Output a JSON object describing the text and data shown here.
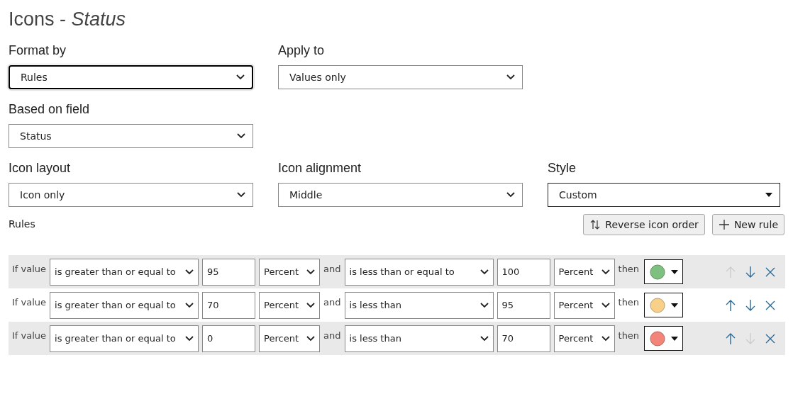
{
  "title": {
    "main": "Icons - ",
    "field": "Status"
  },
  "fields": [
    {
      "label": "Format by",
      "value": "Rules",
      "focused": true,
      "kind": "select"
    },
    {
      "label": "Apply to",
      "value": "Values only",
      "focused": false,
      "kind": "select"
    },
    {
      "label": "Based on field",
      "value": "Status",
      "focused": false,
      "kind": "select"
    },
    {
      "label": "Icon layout",
      "value": "Icon only",
      "focused": false,
      "kind": "select"
    },
    {
      "label": "Icon alignment",
      "value": "Middle",
      "focused": false,
      "kind": "select"
    },
    {
      "label": "Style",
      "value": "Custom",
      "focused": false,
      "kind": "combo"
    }
  ],
  "rules_label": "Rules",
  "buttons": [
    {
      "label": "Reverse icon order",
      "kind": "reverse"
    },
    {
      "label": "New rule",
      "kind": "add"
    }
  ],
  "rules": [
    {
      "if": "If value",
      "op1": "is greater than or equal to",
      "value1": "95",
      "unit1": "Percent",
      "and": "and",
      "op2": "is less than or equal to",
      "value2": "100",
      "unit2": "Percent",
      "then": "then",
      "color": "#7fbf7f",
      "up_disabled": true,
      "down_disabled": false
    },
    {
      "if": "If value",
      "op1": "is greater than or equal to",
      "value1": "70",
      "unit1": "Percent",
      "and": "and",
      "op2": "is less than",
      "value2": "95",
      "unit2": "Percent",
      "then": "then",
      "color": "#f8d08a",
      "up_disabled": false,
      "down_disabled": false
    },
    {
      "if": "If value",
      "op1": "is greater than or equal to",
      "value1": "0",
      "unit1": "Percent",
      "and": "and",
      "op2": "is less than",
      "value2": "70",
      "unit2": "Percent",
      "then": "then",
      "color": "#f2847a",
      "up_disabled": false,
      "down_disabled": true
    }
  ]
}
